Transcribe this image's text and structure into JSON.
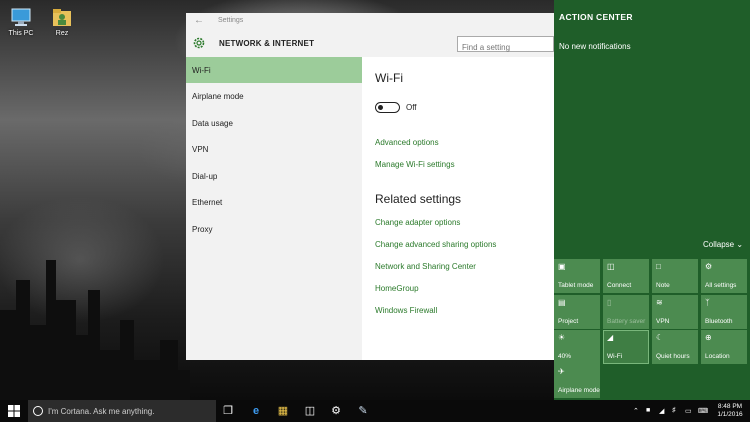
{
  "desktop": {
    "icons": [
      {
        "label": "This PC",
        "icon": "computer-icon"
      },
      {
        "label": "Rez",
        "icon": "user-folder-icon"
      }
    ]
  },
  "settings": {
    "window_title": "Settings",
    "section_title": "NETWORK & INTERNET",
    "search_placeholder": "Find a setting",
    "nav": [
      {
        "label": "Wi-Fi",
        "active": true
      },
      {
        "label": "Airplane mode"
      },
      {
        "label": "Data usage"
      },
      {
        "label": "VPN"
      },
      {
        "label": "Dial-up"
      },
      {
        "label": "Ethernet"
      },
      {
        "label": "Proxy"
      }
    ],
    "content": {
      "heading": "Wi-Fi",
      "toggle_state": "Off",
      "links_primary": [
        "Advanced options",
        "Manage Wi-Fi settings"
      ],
      "related_heading": "Related settings",
      "related_links": [
        "Change adapter options",
        "Change advanced sharing options",
        "Network and Sharing Center",
        "HomeGroup",
        "Windows Firewall"
      ]
    },
    "colors": {
      "accent": "#2b7a2b",
      "nav_active": "#9ccc9a"
    }
  },
  "action_center": {
    "title": "ACTION CENTER",
    "empty_note": "No new notifications",
    "collapse_label": "Collapse",
    "tiles": [
      {
        "label": "Tablet mode",
        "icon": "tablet-mode-icon",
        "state": "off"
      },
      {
        "label": "Connect",
        "icon": "connect-icon",
        "state": "off"
      },
      {
        "label": "Note",
        "icon": "note-icon",
        "state": "off"
      },
      {
        "label": "All settings",
        "icon": "gear-icon",
        "state": "off"
      },
      {
        "label": "Project",
        "icon": "project-icon",
        "state": "off"
      },
      {
        "label": "Battery saver",
        "icon": "battery-saver-icon",
        "state": "disabled"
      },
      {
        "label": "VPN",
        "icon": "vpn-icon",
        "state": "off"
      },
      {
        "label": "Bluetooth",
        "icon": "bluetooth-icon",
        "state": "off"
      },
      {
        "label": "40%",
        "icon": "brightness-icon",
        "state": "off"
      },
      {
        "label": "Wi-Fi",
        "icon": "wifi-icon",
        "state": "on"
      },
      {
        "label": "Quiet hours",
        "icon": "moon-icon",
        "state": "off"
      },
      {
        "label": "Location",
        "icon": "location-icon",
        "state": "off"
      },
      {
        "label": "Airplane mode",
        "icon": "airplane-icon",
        "state": "off"
      }
    ],
    "colors": {
      "background": "#1f5e29",
      "tile": "#4c8b50"
    }
  },
  "taskbar": {
    "cortana_placeholder": "I'm Cortana. Ask me anything.",
    "pinned": [
      "task-view-icon",
      "edge-icon",
      "file-explorer-icon",
      "store-icon",
      "settings-icon",
      "paint-icon"
    ],
    "clock_time": "8:48 PM",
    "clock_date": "1/1/2016"
  }
}
